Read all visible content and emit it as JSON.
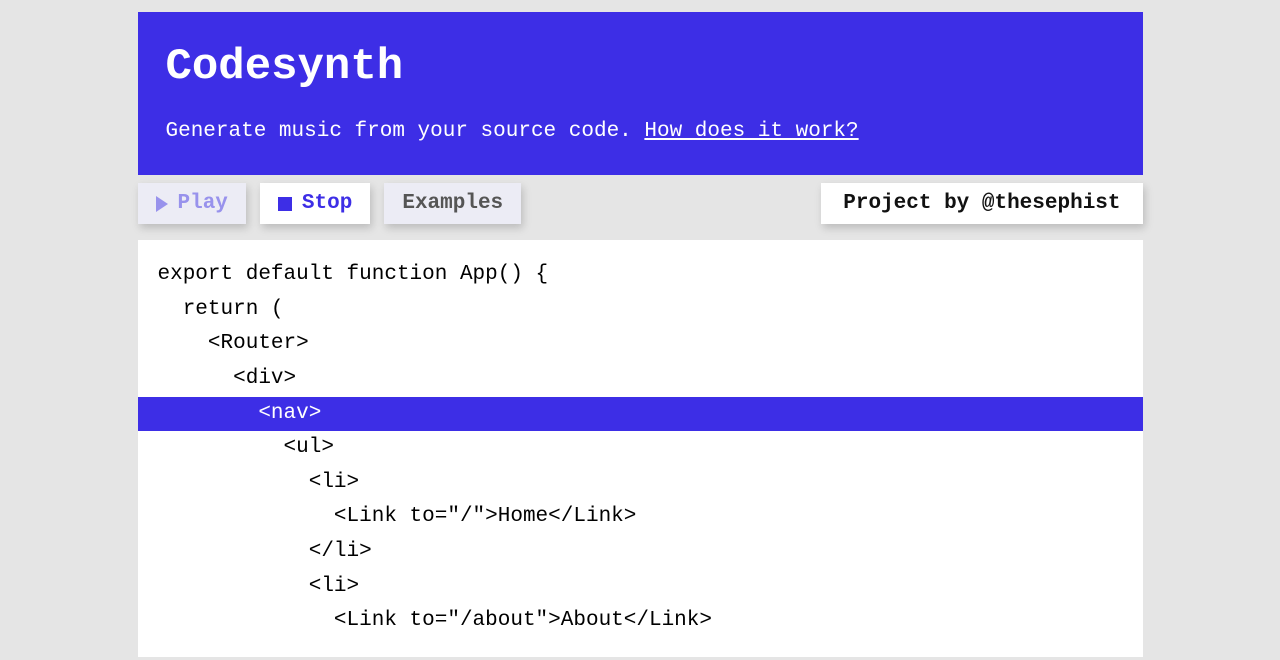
{
  "header": {
    "title": "Codesynth",
    "subtitle_text": "Generate music from your source code. ",
    "subtitle_link": "How does it work?"
  },
  "toolbar": {
    "play_label": "Play",
    "stop_label": "Stop",
    "examples_label": "Examples",
    "credit_prefix": "Project by ",
    "credit_handle": "@thesephist"
  },
  "editor": {
    "highlighted_index": 4,
    "lines": [
      "export default function App() {",
      "  return (",
      "    <Router>",
      "      <div>",
      "        <nav>",
      "          <ul>",
      "            <li>",
      "              <Link to=\"/\">Home</Link>",
      "            </li>",
      "            <li>",
      "              <Link to=\"/about\">About</Link>"
    ]
  }
}
